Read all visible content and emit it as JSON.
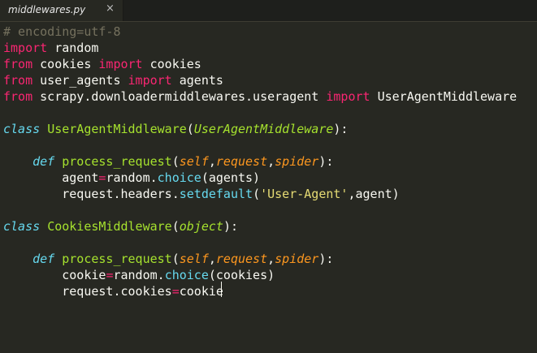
{
  "tab": {
    "title": "middlewares.py",
    "close_glyph": "×"
  },
  "code": {
    "l1": {
      "comment": "# encoding=utf-8"
    },
    "l2": {
      "kw": "import",
      "rest": " random"
    },
    "l3": {
      "kw1": "from",
      "mid": " cookies ",
      "kw2": "import",
      "rest": " cookies"
    },
    "l4": {
      "kw1": "from",
      "mid": " user_agents ",
      "kw2": "import",
      "rest": " agents"
    },
    "l5": {
      "kw1": "from",
      "mid": " scrapy.downloadermiddlewares.useragent ",
      "kw2": "import",
      "rest": " UserAgentMiddleware"
    },
    "l7": {
      "kw": "class",
      "name": "UserAgentMiddleware",
      "open": "(",
      "base": "UserAgentMiddleware",
      "close": "):"
    },
    "l9": {
      "kw": "def",
      "name": "process_request",
      "open": "(",
      "p1": "self",
      "c1": ",",
      "p2": "request",
      "c2": ",",
      "p3": "spider",
      "close": "):"
    },
    "l10": {
      "a": "agent",
      "op": "=",
      "b": "random.",
      "call": "choice",
      "c": "(agents)"
    },
    "l11": {
      "a": "request.headers.",
      "call": "setdefault",
      "b": "(",
      "str": "'User-Agent'",
      "c": ",agent)"
    },
    "l13": {
      "kw": "class",
      "name": "CookiesMiddleware",
      "open": "(",
      "base": "object",
      "close": "):"
    },
    "l15": {
      "kw": "def",
      "name": "process_request",
      "open": "(",
      "p1": "self",
      "c1": ",",
      "p2": "request",
      "c2": ",",
      "p3": "spider",
      "close": "):"
    },
    "l16": {
      "a": "cookie",
      "op": "=",
      "b": "random.",
      "call": "choice",
      "c": "(cookies)"
    },
    "l17": {
      "a": "request.cookies",
      "op": "=",
      "b": "cookie"
    }
  }
}
